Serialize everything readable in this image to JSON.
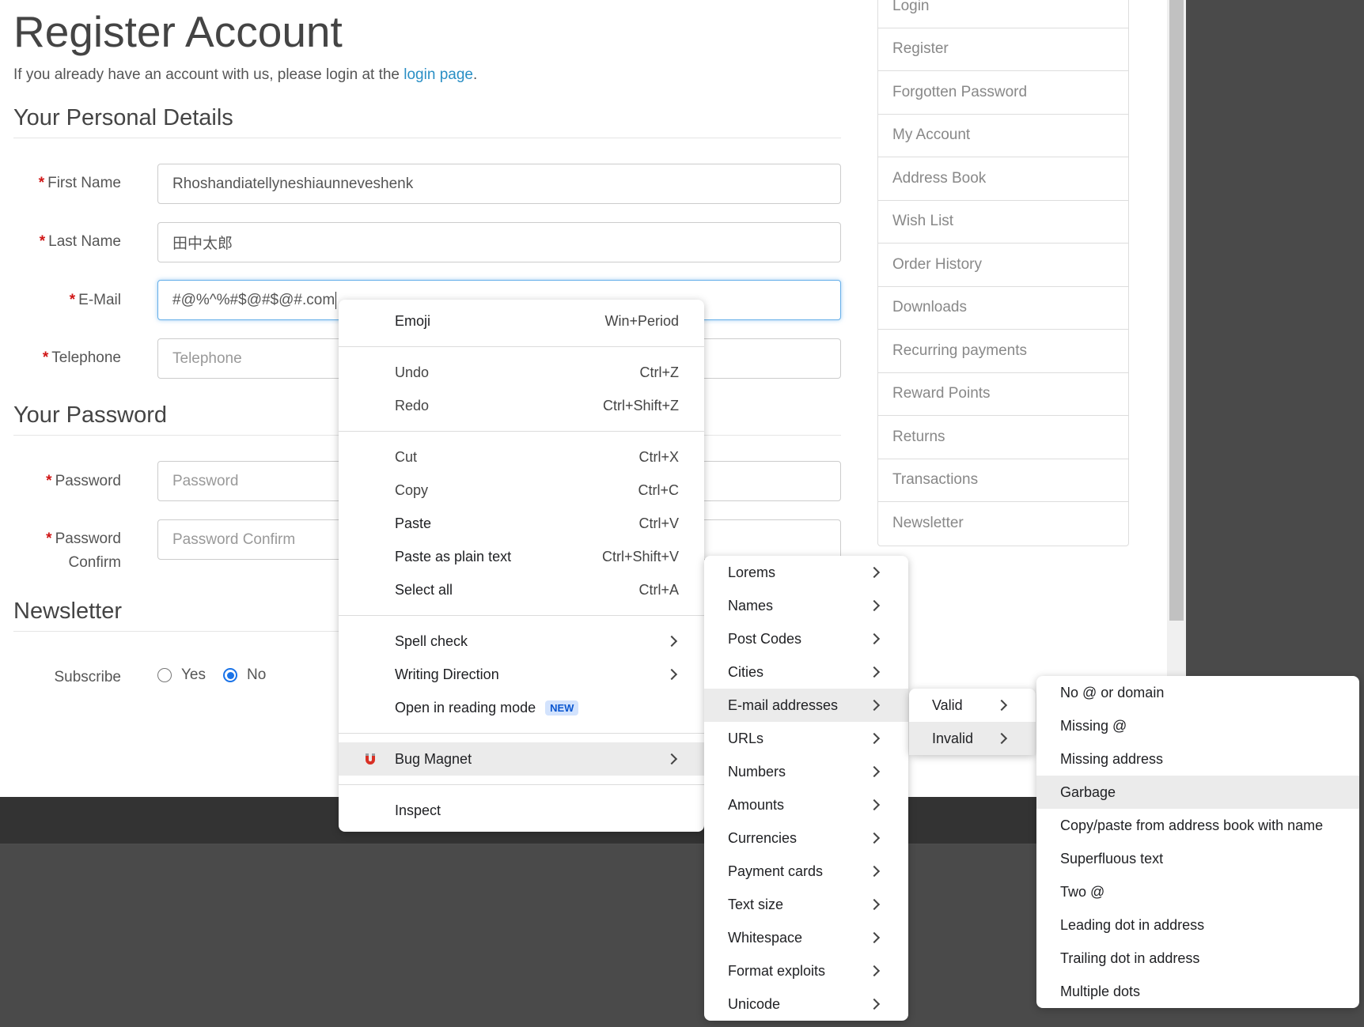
{
  "page": {
    "title": "Register Account",
    "intro_text": "If you already have an account with us, please login at the",
    "intro_link": "login page",
    "intro_end": "."
  },
  "personal": {
    "legend": "Your Personal Details",
    "first_name": {
      "label": "First Name",
      "value": "Rhoshandiatellyneshiaunneveshenk"
    },
    "last_name": {
      "label": "Last Name",
      "value": "田中太郎"
    },
    "email": {
      "label": "E-Mail",
      "value": "#@%^%#$@#$@#.com"
    },
    "telephone": {
      "label": "Telephone",
      "placeholder": "Telephone"
    }
  },
  "password": {
    "legend": "Your Password",
    "password": {
      "label": "Password",
      "placeholder": "Password"
    },
    "confirm": {
      "label_1": "Password",
      "label_2": "Confirm",
      "placeholder": "Password Confirm"
    }
  },
  "newsletter": {
    "legend": "Newsletter",
    "subscribe_label": "Subscribe",
    "yes": "Yes",
    "no": "No",
    "selected": "No"
  },
  "sidebar": {
    "items": [
      "Login",
      "Register",
      "Forgotten Password",
      "My Account",
      "Address Book",
      "Wish List",
      "Order History",
      "Downloads",
      "Recurring payments",
      "Reward Points",
      "Returns",
      "Transactions",
      "Newsletter"
    ]
  },
  "context_menu": {
    "emoji": {
      "label": "Emoji",
      "shortcut": "Win+Period"
    },
    "undo": {
      "label": "Undo",
      "shortcut": "Ctrl+Z"
    },
    "redo": {
      "label": "Redo",
      "shortcut": "Ctrl+Shift+Z"
    },
    "cut": {
      "label": "Cut",
      "shortcut": "Ctrl+X"
    },
    "copy": {
      "label": "Copy",
      "shortcut": "Ctrl+C"
    },
    "paste": {
      "label": "Paste",
      "shortcut": "Ctrl+V"
    },
    "paste_plain": {
      "label": "Paste as plain text",
      "shortcut": "Ctrl+Shift+V"
    },
    "select_all": {
      "label": "Select all",
      "shortcut": "Ctrl+A"
    },
    "spell_check": "Spell check",
    "writing_direction": "Writing Direction",
    "reading_mode": "Open in reading mode",
    "new_badge": "NEW",
    "bug_magnet": "Bug Magnet",
    "inspect": "Inspect"
  },
  "bug_magnet_menu": {
    "items": [
      "Lorems",
      "Names",
      "Post Codes",
      "Cities",
      "E-mail addresses",
      "URLs",
      "Numbers",
      "Amounts",
      "Currencies",
      "Payment cards",
      "Text size",
      "Whitespace",
      "Format exploits",
      "Unicode"
    ],
    "highlighted": "E-mail addresses"
  },
  "email_menu": {
    "items": [
      "Valid",
      "Invalid"
    ],
    "highlighted": "Invalid"
  },
  "invalid_menu": {
    "items": [
      "No @ or domain",
      "Missing @",
      "Missing address",
      "Garbage",
      "Copy/paste from address book with name",
      "Superfluous text",
      "Two @",
      "Leading dot in address",
      "Trailing dot in address",
      "Multiple dots"
    ],
    "highlighted": "Garbage"
  },
  "colors": {
    "accent": "#2a8fc5",
    "required": "#d01616",
    "radio": "#1a73e8"
  },
  "icons": {
    "bug_magnet": "magnet-icon",
    "submenu": "chevron-right-icon"
  }
}
